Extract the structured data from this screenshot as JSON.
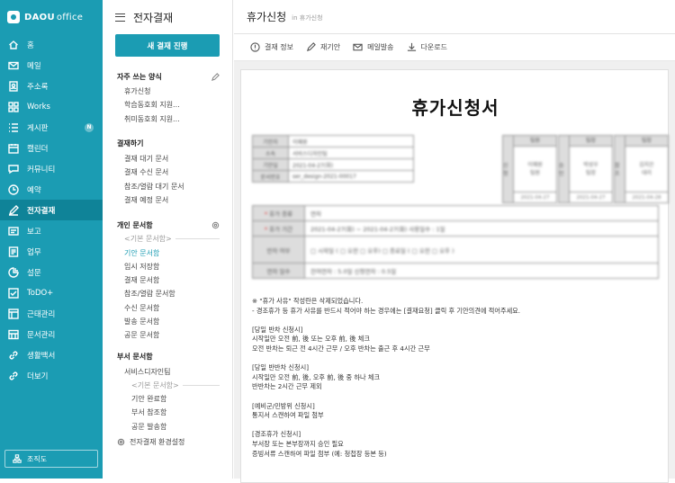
{
  "brand": {
    "logo_bold": "DAOU",
    "logo_light": "office"
  },
  "nav": [
    {
      "label": "홈",
      "icon": "home-icon"
    },
    {
      "label": "메일",
      "icon": "mail-icon"
    },
    {
      "label": "주소록",
      "icon": "contacts-icon"
    },
    {
      "label": "Works",
      "icon": "grid-icon"
    },
    {
      "label": "게시판",
      "icon": "board-icon",
      "badge": "N"
    },
    {
      "label": "캘린더",
      "icon": "calendar-icon"
    },
    {
      "label": "커뮤니티",
      "icon": "chat-icon"
    },
    {
      "label": "예약",
      "icon": "clock-icon"
    },
    {
      "label": "전자결재",
      "icon": "approval-icon",
      "active": true
    },
    {
      "label": "보고",
      "icon": "report-icon"
    },
    {
      "label": "업무",
      "icon": "task-icon"
    },
    {
      "label": "설문",
      "icon": "survey-icon"
    },
    {
      "label": "ToDO+",
      "icon": "todo-icon"
    },
    {
      "label": "근태관리",
      "icon": "attendance-icon"
    },
    {
      "label": "문서관리",
      "icon": "docs-icon"
    },
    {
      "label": "생활백서",
      "icon": "link-icon"
    },
    {
      "label": "더보기",
      "icon": "more-link-icon"
    }
  ],
  "org_button": "조직도",
  "sidebar": {
    "title": "전자결재",
    "new_button": "새 결재 진행",
    "favorites_title": "자주 쓰는 양식",
    "favorites": [
      "휴가신청",
      "학습동호회 지원...",
      "취미동호회 지원..."
    ],
    "approval_title": "결재하기",
    "approval_items": [
      "결재 대기 문서",
      "결재 수신 문서",
      "참조/열람 대기 문서",
      "결재 예정 문서"
    ],
    "personal_title": "개인 문서함",
    "personal_sub": "<기본 문서함>",
    "personal_items": [
      "기안 문서함",
      "임시 저장함",
      "결재 문서함",
      "참조/열람 문서함",
      "수신 문서함",
      "발송 문서함",
      "공문 문서함"
    ],
    "dept_title": "부서 문서함",
    "dept_name": "서비스디자인팀",
    "dept_sub": "<기본 문서함>",
    "dept_items": [
      "기안 완료함",
      "부서 참조함",
      "공문 발송함"
    ],
    "settings": "전자결재 환경설정"
  },
  "main": {
    "title": "휴가신청",
    "location": "in 휴가신청",
    "toolbar": [
      {
        "label": "결재 정보",
        "icon": "info-icon"
      },
      {
        "label": "재기안",
        "icon": "redraft-icon"
      },
      {
        "label": "메일발송",
        "icon": "mail-send-icon"
      },
      {
        "label": "다운로드",
        "icon": "download-icon"
      }
    ]
  },
  "document": {
    "title": "휴가신청서",
    "info_rows": [
      {
        "label": "기안자",
        "value": "이혜원"
      },
      {
        "label": "소속",
        "value": "서비스디자인팀"
      },
      {
        "label": "기안일",
        "value": "2021-04-27(화)"
      },
      {
        "label": "문서번호",
        "value": "ser_design-2021-00017"
      }
    ],
    "approval_boxes": [
      {
        "side": "신청",
        "cols": [
          {
            "head": "팀원",
            "name": "이혜원\n팀원",
            "date": "2021-04-27"
          }
        ]
      },
      {
        "side": "승인",
        "cols": [
          {
            "head": "팀장",
            "name": "박성우\n팀장",
            "date": "2021-04-27"
          }
        ]
      },
      {
        "side": "참조",
        "cols": [
          {
            "head": "팀장",
            "name": "김지은\n대리",
            "date": "2021-04-28"
          }
        ]
      }
    ],
    "form_rows": [
      {
        "label": "휴가 종류",
        "required": true,
        "value": "연차"
      },
      {
        "label": "휴가 기간",
        "required": true,
        "value": "2021-04-27(화) ~ 2021-04-27(화)   사용일수 : 1일"
      },
      {
        "label": "반차 여부",
        "required": false,
        "value": "□ 시작일 ( □ 오전 □ 오후)   □ 종료일 ( □ 오전 □ 오후 )"
      },
      {
        "label": "연차 일수",
        "required": false,
        "value": "잔여연차 : 5.0일    신청연차 : 0.5일"
      }
    ],
    "notes": [
      "※ \"휴가 사유\" 작성란은 삭제되었습니다.",
      "- 경조휴가 등 휴가 사유를 반드시 적어야 하는 경우에는 [결재요청] 클릭 후 기안의견에 적어주세요.",
      "",
      "[당일 반차 신청시]",
      "시작일만 오전 前, 後 또는 오후 前, 後 체크",
      "오전 반차는 퇴근 전 4시간 근무 / 오후 반차는 출근 후 4시간 근무",
      "",
      "[당일 반반차 신청시]",
      "시작일만 오전 前, 後, 오후 前, 後 중 하나 체크",
      "반반차는 2시간 근무 제외",
      "",
      "[예비군/민방위 신청시]",
      "통지서 스캔하여 파일 첨부",
      "",
      "[경조휴가 신청시]",
      "부서장 또는 본부장까지 승인 필요",
      "증빙서류 스캔하여 파일 첨부 (예: 청첩장 등본 등)"
    ]
  }
}
